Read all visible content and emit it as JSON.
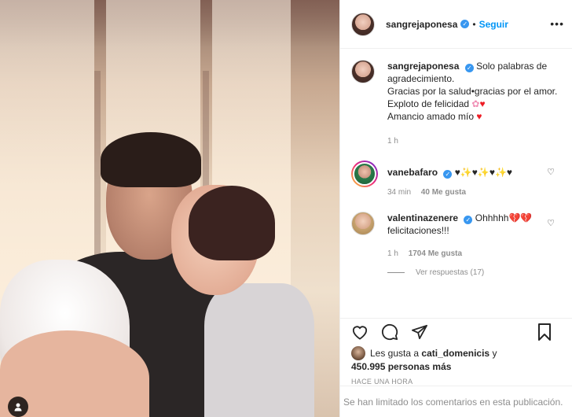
{
  "post": {
    "username": "sangrejaponesa",
    "follow_label": "Seguir",
    "more_icon": "•••"
  },
  "caption": {
    "username": "sangrejaponesa",
    "line1": "Solo palabras de agradecimiento.",
    "line2": "Gracias por la salud•gracias por el amor.",
    "line3": "Exploto de felicidad",
    "line4": "Amancio amado mío",
    "time": "1 h"
  },
  "comments": [
    {
      "username": "vanebafaro",
      "text": "♥✨♥✨♥✨♥",
      "time": "34 min",
      "likes": "40 Me gusta"
    },
    {
      "username": "valentinazenere",
      "text": "Ohhhhh💔💔 felicitaciones!!!",
      "time": "1 h",
      "likes": "1704 Me gusta",
      "replies": "Ver respuestas (17)"
    }
  ],
  "likes": {
    "prefix": "Les gusta a",
    "user": "cati_domenicis",
    "suffix": "y",
    "count": "450.995 personas más"
  },
  "timestamp": "HACE UNA HORA",
  "comments_limited": "Se han limitado los comentarios en esta publicación.",
  "colors": {
    "accent": "#0095f6",
    "verified": "#3897f0",
    "muted": "#8e8e8e",
    "heart": "#ed1c24"
  },
  "icons": [
    "heart-icon",
    "comment-icon",
    "share-icon",
    "bookmark-icon",
    "user-tag-icon",
    "verified-icon",
    "more-icon"
  ]
}
